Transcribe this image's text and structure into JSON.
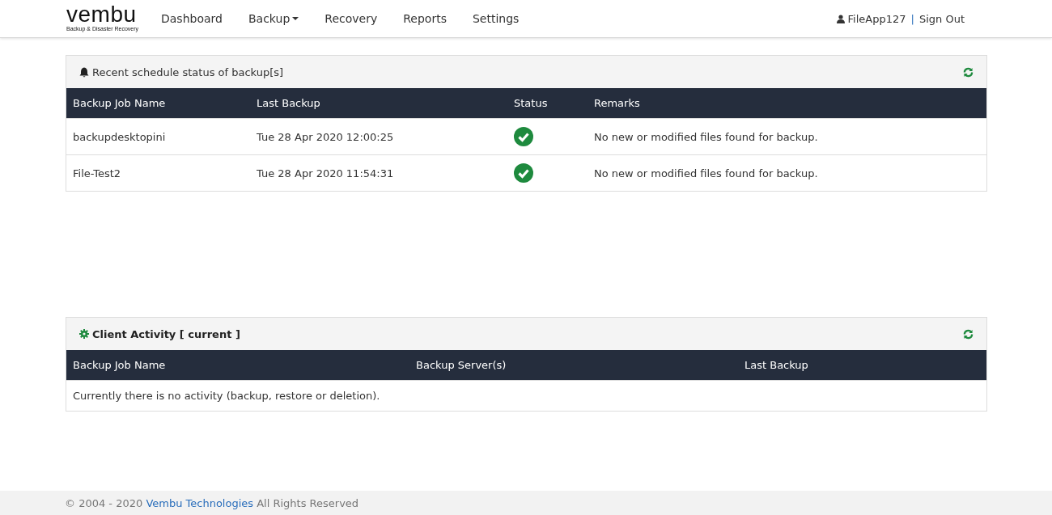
{
  "header": {
    "logo": {
      "name": "vembu",
      "tagline": "Backup & Disaster Recovery"
    },
    "nav": [
      {
        "label": "Dashboard",
        "dropdown": false
      },
      {
        "label": "Backup",
        "dropdown": true
      },
      {
        "label": "Recovery",
        "dropdown": false
      },
      {
        "label": "Reports",
        "dropdown": false
      },
      {
        "label": "Settings",
        "dropdown": false
      }
    ],
    "user": "FileApp127",
    "separator": "|",
    "sign_out": "Sign Out"
  },
  "schedule_panel": {
    "title": "Recent schedule status of backup[s]",
    "columns": [
      "Backup Job Name",
      "Last Backup",
      "Status",
      "Remarks"
    ],
    "rows": [
      {
        "name": "backupdesktopini",
        "last_backup": "Tue 28 Apr 2020 12:00:25",
        "succeeded": true,
        "remarks": "No new or modified files found for backup."
      },
      {
        "name": "File-Test2",
        "last_backup": "Tue 28 Apr 2020 11:54:31",
        "succeeded": true,
        "remarks": "No new or modified files found for backup."
      }
    ]
  },
  "activity_panel": {
    "title": "Client Activity [ current ]",
    "columns": [
      "Backup Job Name",
      "Backup Server(s)",
      "Last Backup"
    ],
    "empty_message": "Currently there is no activity (backup, restore or deletion)."
  },
  "footer": {
    "prefix": "© 2004 - 2020",
    "link": "Vembu Technologies",
    "suffix": "All Rights Reserved"
  }
}
